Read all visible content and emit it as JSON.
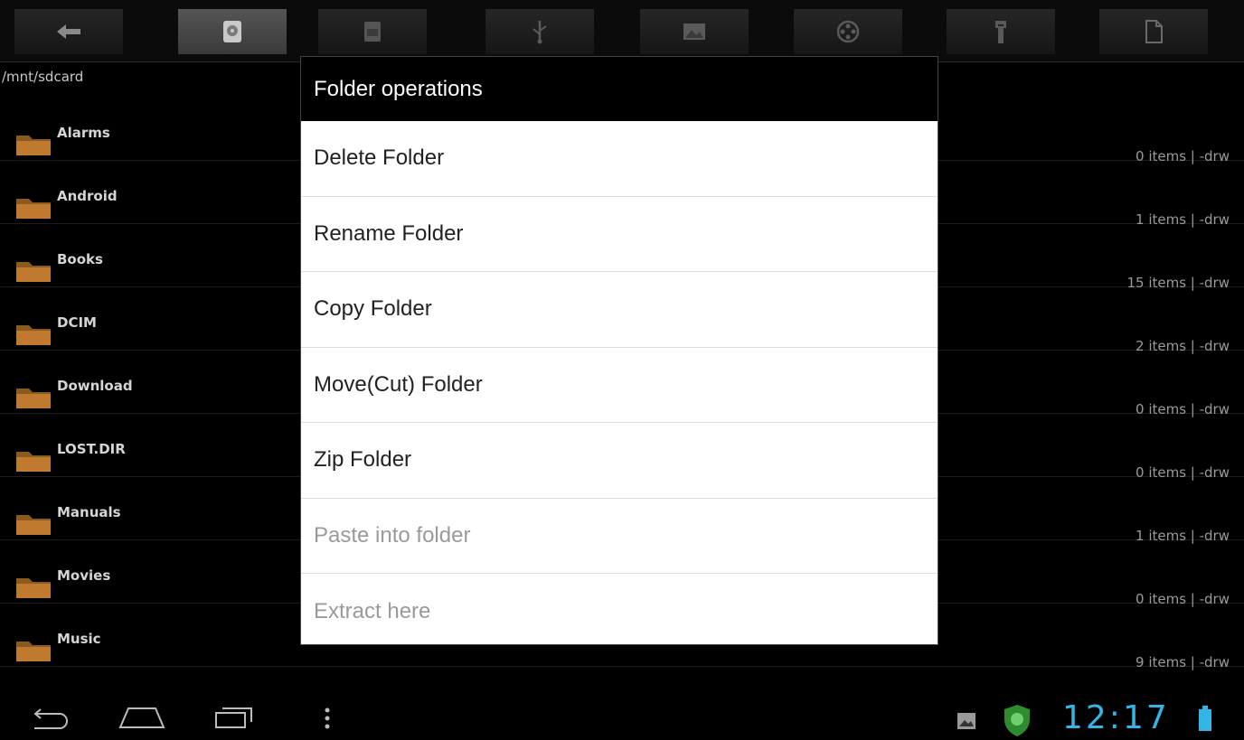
{
  "path": "/mnt/sdcard",
  "toolbar": {
    "buttons": [
      {
        "icon": "back-arrow-icon"
      },
      {
        "icon": "sdcard-icon",
        "active": true
      },
      {
        "icon": "internal-storage-icon"
      },
      {
        "icon": "usb-icon"
      },
      {
        "icon": "image-icon"
      },
      {
        "icon": "film-reel-icon"
      },
      {
        "icon": "wrench-icon"
      },
      {
        "icon": "document-icon"
      }
    ]
  },
  "files": [
    {
      "name": "Alarms",
      "meta": "0 items | -drw"
    },
    {
      "name": "Android",
      "meta": "1 items | -drw"
    },
    {
      "name": "Books",
      "meta": "15 items | -drw"
    },
    {
      "name": "DCIM",
      "meta": "2 items | -drw"
    },
    {
      "name": "Download",
      "meta": "0 items | -drw"
    },
    {
      "name": "LOST.DIR",
      "meta": "0 items | -drw"
    },
    {
      "name": "Manuals",
      "meta": "1 items | -drw"
    },
    {
      "name": "Movies",
      "meta": "0 items | -drw"
    },
    {
      "name": "Music",
      "meta": "9 items | -drw"
    }
  ],
  "dialog": {
    "title": "Folder operations",
    "items": [
      {
        "label": "Delete Folder",
        "enabled": true
      },
      {
        "label": "Rename Folder",
        "enabled": true
      },
      {
        "label": "Copy Folder",
        "enabled": true
      },
      {
        "label": "Move(Cut) Folder",
        "enabled": true
      },
      {
        "label": "Zip Folder",
        "enabled": true
      },
      {
        "label": "Paste into folder",
        "enabled": false
      },
      {
        "label": "Extract here",
        "enabled": false
      }
    ]
  },
  "status": {
    "time": "12:17",
    "accent_color": "#33b5e5"
  }
}
